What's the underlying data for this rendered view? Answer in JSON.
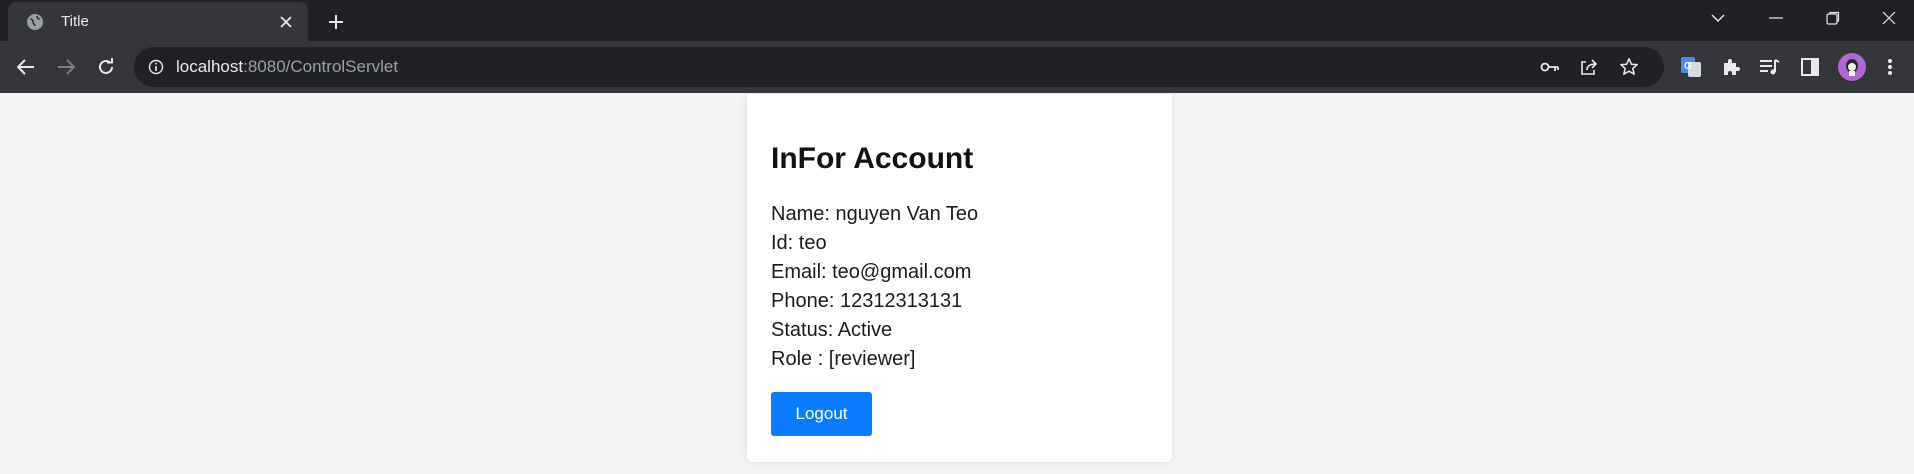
{
  "browser": {
    "tab": {
      "title": "Title"
    },
    "address_bar": {
      "host": "localhost",
      "path": ":8080/ControlServlet"
    }
  },
  "account": {
    "heading": "InFor Account",
    "fields": [
      "Name: nguyen Van Teo",
      "Id: teo",
      "Email: teo@gmail.com",
      "Phone: 12312313131",
      "Status: Active",
      "Role : [reviewer]"
    ],
    "logout_label": "Logout"
  },
  "colors": {
    "page_background": "#f4f4f4",
    "button": "#0a7cff",
    "browser_frame": "#202124",
    "avatar": "#b267d9"
  }
}
